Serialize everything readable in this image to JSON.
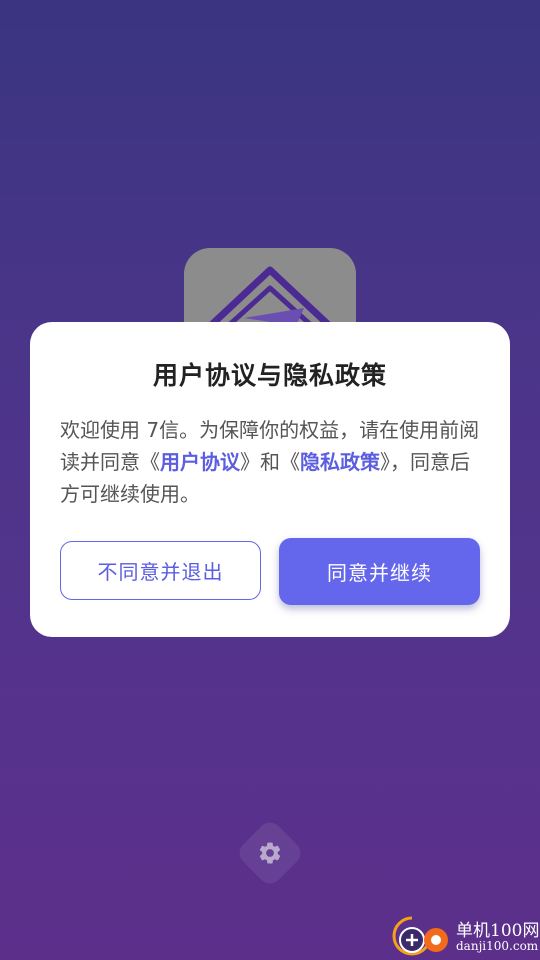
{
  "app_name": "7信",
  "dialog": {
    "title": "用户协议与隐私政策",
    "body_part1": "欢迎使用 7信。为保障你的权益，请在使用前阅读并同意《",
    "user_agreement_link": "用户协议",
    "body_part2": "》和《",
    "privacy_policy_link": "隐私政策",
    "body_part3": "》，同意后方可继续使用。",
    "decline_label": "不同意并退出",
    "accept_label": "同意并继续"
  },
  "settings": {
    "icon": "gear-icon"
  },
  "watermark": {
    "name": "单机100网",
    "url": "danji100.com"
  },
  "colors": {
    "accent": "#6466ec",
    "link": "#5b5ee0",
    "background_top": "#3a3580",
    "background_bottom": "#5c2f8b"
  }
}
